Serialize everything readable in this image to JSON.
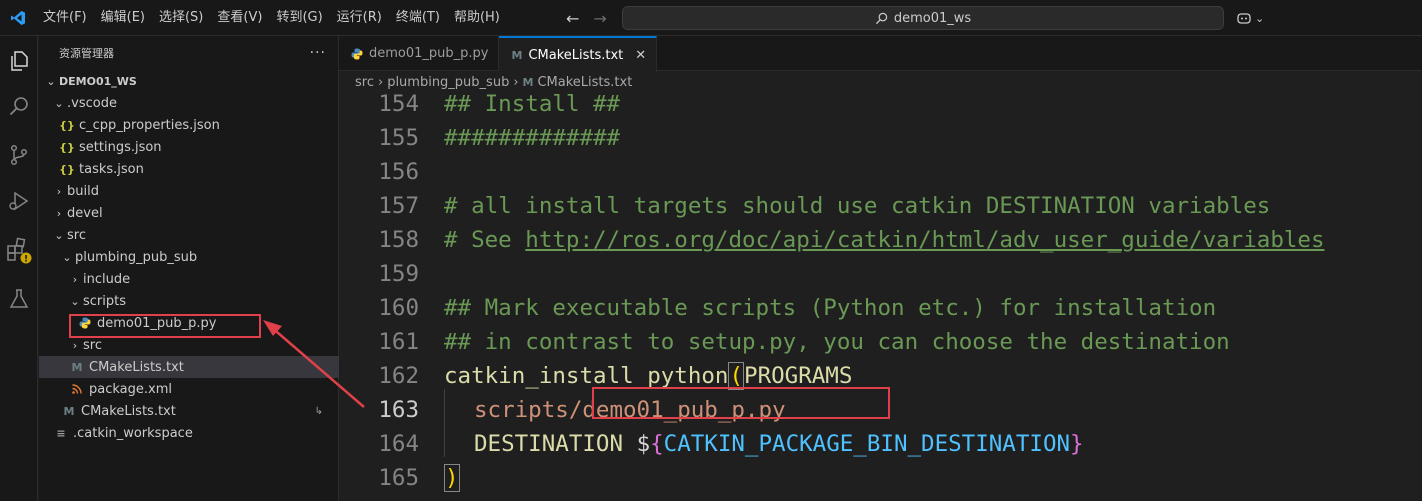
{
  "menu": [
    "文件(F)",
    "编辑(E)",
    "选择(S)",
    "查看(V)",
    "转到(G)",
    "运行(R)",
    "终端(T)",
    "帮助(H)"
  ],
  "search": {
    "label": "demo01_ws"
  },
  "sidebar": {
    "title": "资源管理器",
    "workspace": "DEMO01_WS",
    "items": [
      {
        "label": ".vscode"
      },
      {
        "label": "c_cpp_properties.json"
      },
      {
        "label": "settings.json"
      },
      {
        "label": "tasks.json"
      },
      {
        "label": "build"
      },
      {
        "label": "devel"
      },
      {
        "label": "src"
      },
      {
        "label": "plumbing_pub_sub"
      },
      {
        "label": "include"
      },
      {
        "label": "scripts"
      },
      {
        "label": "demo01_pub_p.py"
      },
      {
        "label": "src"
      },
      {
        "label": "CMakeLists.txt"
      },
      {
        "label": "package.xml"
      },
      {
        "label": "CMakeLists.txt"
      },
      {
        "label": ".catkin_workspace"
      }
    ]
  },
  "tabs": [
    {
      "label": "demo01_pub_p.py"
    },
    {
      "label": "CMakeLists.txt"
    }
  ],
  "breadcrumb": [
    "src",
    "plumbing_pub_sub",
    "CMakeLists.txt"
  ],
  "code": {
    "lines": [
      {
        "n": "154",
        "text": "## Install ##"
      },
      {
        "n": "155",
        "text": "#############"
      },
      {
        "n": "156",
        "text": ""
      },
      {
        "n": "157",
        "text": "# all install targets should use catkin DESTINATION variables"
      },
      {
        "n": "158",
        "prefix": "# See ",
        "link": "http://ros.org/doc/api/catkin/html/adv_user_guide/variables"
      },
      {
        "n": "159",
        "text": ""
      },
      {
        "n": "160",
        "text": "## Mark executable scripts (Python etc.) for installation"
      },
      {
        "n": "161",
        "text": "## in contrast to setup.py, you can choose the destination"
      },
      {
        "n": "162",
        "fn": "catkin_install_python",
        "open": "(",
        "arg": "PROGRAMS"
      },
      {
        "n": "163",
        "path": "scripts/",
        "file": "demo01_pub_p.py"
      },
      {
        "n": "164",
        "key": "DESTINATION",
        "dollar": "$",
        "ob": "{",
        "var": "CATKIN_PACKAGE_BIN_DESTINATION",
        "cb": "}"
      },
      {
        "n": "165",
        "close": ")"
      }
    ]
  },
  "colors": {
    "accent": "#0078d4",
    "highlight_box": "#e0404a",
    "comment": "#6a9955",
    "function": "#dcdcaa"
  }
}
